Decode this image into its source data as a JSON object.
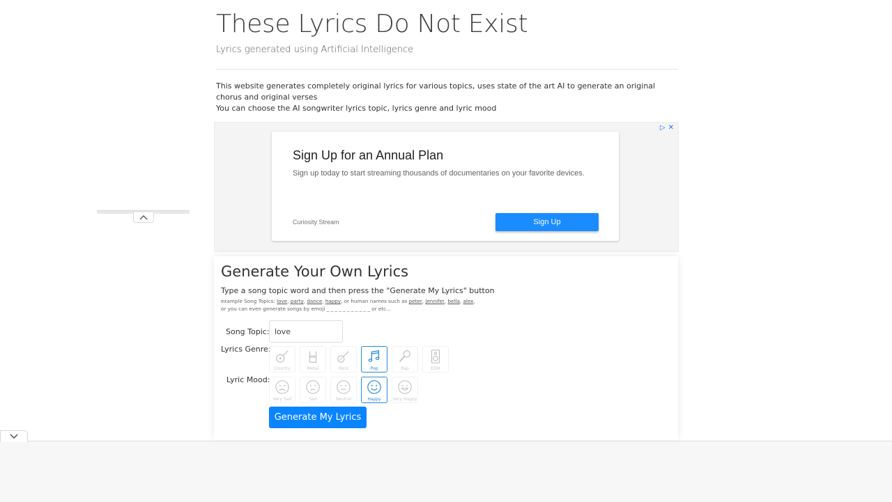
{
  "header": {
    "title": "These Lyrics Do Not Exist",
    "subtitle": "Lyrics generated using Artificial Intelligence"
  },
  "intro": {
    "line1": "This website generates completely original lyrics for various topics, uses state of the art AI to generate an original chorus and original verses",
    "line2": "You can choose the AI songwriter lyrics topic, lyrics genre and lyric mood"
  },
  "ad": {
    "headline": "Sign Up for an Annual Plan",
    "description": "Sign up today to start streaming thousands of documentaries on your favorite devices.",
    "advertiser": "Curiosity Stream",
    "cta": "Sign Up",
    "marker_play": "▷",
    "marker_close": "✕"
  },
  "generator": {
    "title": "Generate Your Own Lyrics",
    "instruction": "Type a song topic word and then press the \"Generate My Lyrics\" button",
    "examples_prefix": "example Song Topics: ",
    "topic_links": [
      "love",
      "party",
      "dance",
      "happy"
    ],
    "names_text": ", or human names such as ",
    "name_links": [
      "peter",
      "jennifer",
      "bella",
      "alex"
    ],
    "emoji_text": "or you can even generate songs by emoji _ _ _ _ _ _ _ _ _ _ _ or etc...",
    "topic_label": "Song Topic:",
    "topic_value": "love",
    "genre_label": "Lyrics Genre:",
    "genres": [
      {
        "label": "Country",
        "icon": "banjo-icon",
        "selected": false
      },
      {
        "label": "Metal",
        "icon": "rock-hand-icon",
        "selected": false
      },
      {
        "label": "Rock",
        "icon": "guitar-icon",
        "selected": false
      },
      {
        "label": "Pop",
        "icon": "music-notes-icon",
        "selected": true
      },
      {
        "label": "Rap",
        "icon": "microphone-icon",
        "selected": false
      },
      {
        "label": "EDM",
        "icon": "speaker-icon",
        "selected": false
      }
    ],
    "mood_label": "Lyric Mood:",
    "moods": [
      {
        "label": "Very Sad",
        "icon": "very-sad-face-icon",
        "selected": false
      },
      {
        "label": "Sad",
        "icon": "sad-face-icon",
        "selected": false
      },
      {
        "label": "Neutral",
        "icon": "neutral-face-icon",
        "selected": false
      },
      {
        "label": "Happy",
        "icon": "happy-face-icon",
        "selected": true
      },
      {
        "label": "Very Happy",
        "icon": "very-happy-face-icon",
        "selected": false
      }
    ],
    "button": "Generate My Lyrics"
  },
  "colors": {
    "accent": "#0a84ff",
    "selected_border": "#2a8ad8",
    "ad_cta": "#1a8cff"
  }
}
